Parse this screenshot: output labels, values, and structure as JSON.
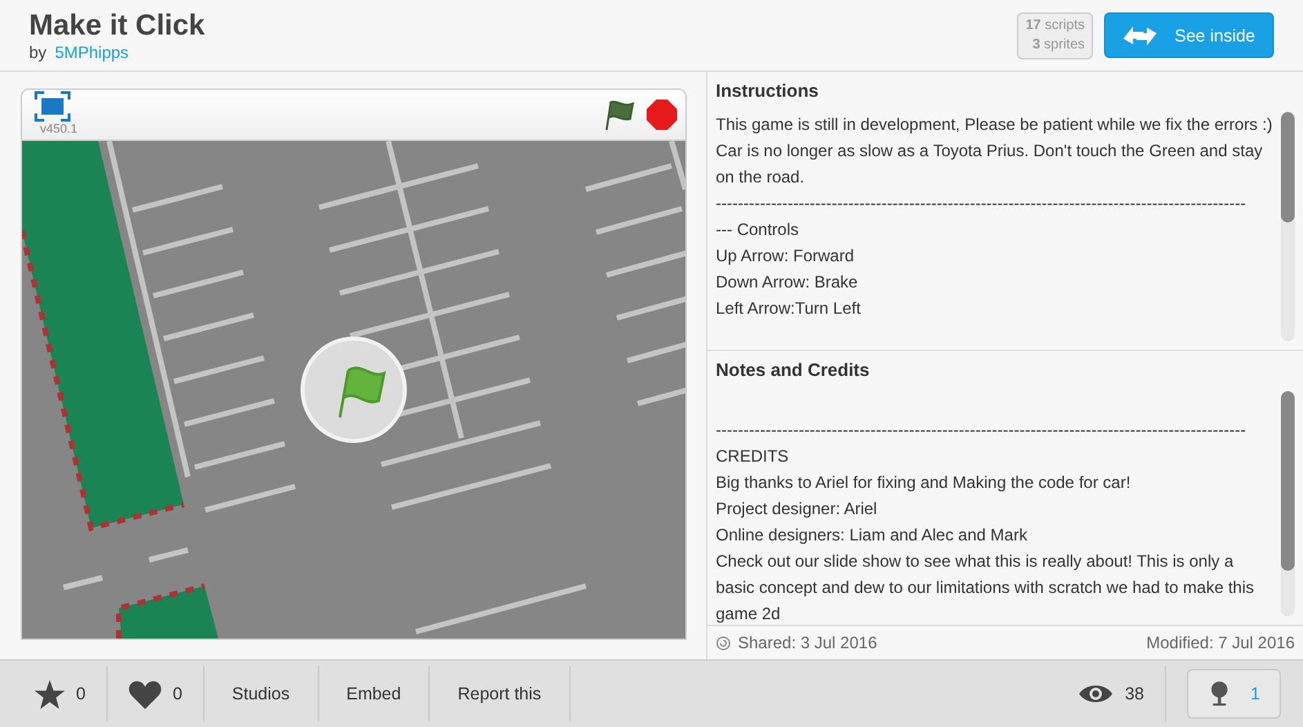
{
  "project": {
    "title": "Make it Click",
    "by": "by",
    "author": "5MPhipps"
  },
  "stats": {
    "scripts_count": "17",
    "scripts_label": "scripts",
    "sprites_count": "3",
    "sprites_label": "sprites"
  },
  "see_inside": "See inside",
  "player": {
    "version": "v450.1"
  },
  "instructions": {
    "heading": "Instructions",
    "lines": [
      "This game is still in development, Please be patient while we fix the errors :) Car is no longer as slow as a Toyota Prius. Don't touch the Green and stay on the road.",
      "------------------------------------------------------------------------------------------------",
      "--- Controls",
      "Up Arrow: Forward",
      "Down Arrow: Brake",
      "Left Arrow:Turn Left"
    ]
  },
  "notes": {
    "heading": "Notes and Credits",
    "lines": [
      "------------------------------------------------------------------------------------------------",
      "CREDITS",
      "Big thanks to Ariel for fixing and Making the code for car!",
      "Project designer: Ariel",
      "Online designers: Liam and Alec and Mark",
      "Check out our slide show to see what this is really about! This is only a basic concept and dew to our limitations with scratch we had to make this game 2d"
    ]
  },
  "dates": {
    "shared": "Shared: 3 Jul 2016",
    "modified": "Modified: 7 Jul 2016"
  },
  "footer": {
    "stars": "0",
    "loves": "0",
    "actions": [
      "Studios",
      "Embed",
      "Report this"
    ],
    "views": "38",
    "remixes": "1"
  }
}
